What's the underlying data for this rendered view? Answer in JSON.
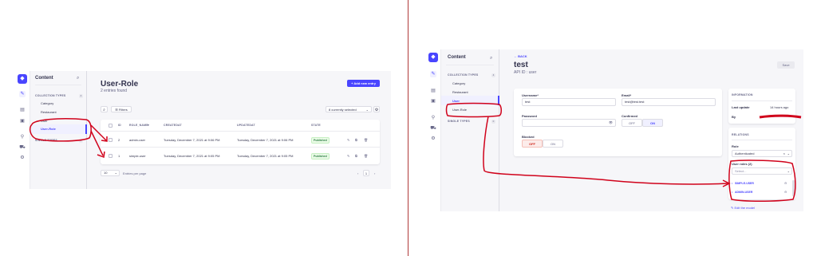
{
  "left": {
    "sidebar": {
      "title": "Content",
      "section": "COLLECTION TYPES",
      "section_count": "4",
      "items": [
        {
          "label": "Category"
        },
        {
          "label": "Restaurant"
        },
        {
          "label": "User"
        },
        {
          "label": "User-Role"
        }
      ],
      "single_types": "SINGLE TYPES",
      "single_count": "0"
    },
    "header": {
      "title": "User-Role",
      "subtitle": "2 entries found",
      "add_button": "+ Add new entry"
    },
    "toolbar": {
      "filters_label": "Filters",
      "selected_label": "8 currently selected"
    },
    "table": {
      "columns": [
        "ID",
        "ROLE_NAME",
        "CREATEDAT",
        "UPDATEDAT",
        "STATE"
      ],
      "rows": [
        {
          "id": "2",
          "role_name": "admin-user",
          "created": "Tuesday, December 7, 2021 at 9:06 PM",
          "updated": "Tuesday, December 7, 2021 at 9:06 PM",
          "state": "Published"
        },
        {
          "id": "1",
          "role_name": "simple-user",
          "created": "Tuesday, December 7, 2021 at 9:05 PM",
          "updated": "Tuesday, December 7, 2021 at 9:05 PM",
          "state": "Published"
        }
      ]
    },
    "pagination": {
      "page_size": "10",
      "per_page_label": "Entries per page",
      "current_page": "1"
    }
  },
  "right": {
    "sidebar": {
      "title": "Content",
      "section": "COLLECTION TYPES",
      "section_count": "4",
      "items": [
        {
          "label": "Category"
        },
        {
          "label": "Restaurant"
        },
        {
          "label": "User"
        },
        {
          "label": "User-Role"
        }
      ],
      "single_types": "SINGLE TYPES",
      "single_count": "0"
    },
    "header": {
      "back": "← BACK",
      "title": "test",
      "api_id": "API ID : user",
      "save": "Save"
    },
    "form": {
      "username_label": "Username*",
      "username_value": "test",
      "email_label": "Email*",
      "email_value": "test@test.test",
      "password_label": "Password",
      "confirmed_label": "Confirmed",
      "confirmed_off": "OFF",
      "confirmed_on": "ON",
      "blocked_label": "Blocked",
      "blocked_off": "OFF",
      "blocked_on": "ON"
    },
    "info": {
      "heading": "INFORMATION",
      "last_update_label": "Last update",
      "last_update_value": "14 hours ago",
      "by_label": "By"
    },
    "relations": {
      "heading": "RELATIONS",
      "role_label": "Role",
      "role_value": "Authenticated",
      "user_roles_label": "User roles (2)",
      "select_placeholder": "Select...",
      "items": [
        {
          "label": "SIMPLE-USER"
        },
        {
          "label": "ADMIN-USER"
        }
      ]
    },
    "edit_model": "✎ Edit the model"
  },
  "colors": {
    "accent": "#4945ff",
    "annotation": "#d0021b",
    "published": "#328048"
  }
}
